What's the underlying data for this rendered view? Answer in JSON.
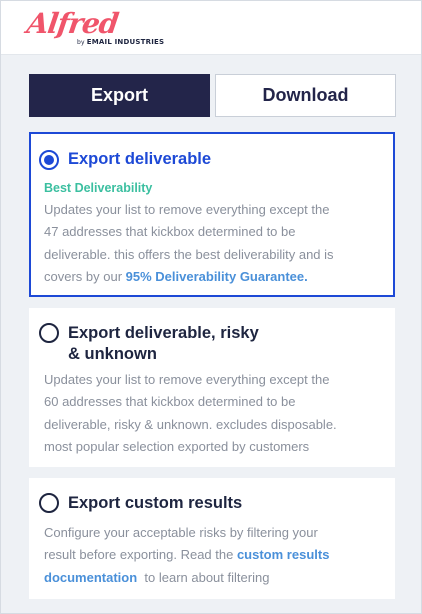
{
  "brand": {
    "logo_word": "Alfred",
    "logo_by": "by",
    "logo_company": "EMAIL INDUSTRIES",
    "accent_color": "#f0556b"
  },
  "tabs": [
    {
      "label": "Export",
      "active": true
    },
    {
      "label": "Download",
      "active": false
    }
  ],
  "options": [
    {
      "title": "Export deliverable",
      "selected": true,
      "badge": "Best Deliverability",
      "desc_lines": [
        "Updates your list to remove everything except the",
        "47 addresses that kickbox determined to be",
        "deliverable. this offers the best deliverability and is"
      ],
      "desc_tail_prefix": "covers by our ",
      "desc_link": "95% Deliverability Guarantee."
    },
    {
      "title_line1": "Export deliverable, risky",
      "title_line2": "& unknown",
      "selected": false,
      "desc_lines": [
        "Updates your list to remove everything except the",
        "60 addresses that kickbox determined to be",
        "deliverable, risky & unknown. excludes disposable.",
        "most popular selection exported by customers"
      ]
    },
    {
      "title": "Export custom results",
      "selected": false,
      "desc_lines": [
        "Configure your acceptable risks by filtering your"
      ],
      "desc_line2_prefix": "result before exporting. Read the ",
      "desc_link_part1": "custom results",
      "desc_link_part2": "documentation",
      "desc_line3_suffix": "  to learn about filtering"
    }
  ],
  "colors": {
    "primary_navy": "#23254a",
    "selected_blue": "#1d49d6",
    "badge_green": "#3bbfa0",
    "link_blue": "#4a90d9"
  }
}
